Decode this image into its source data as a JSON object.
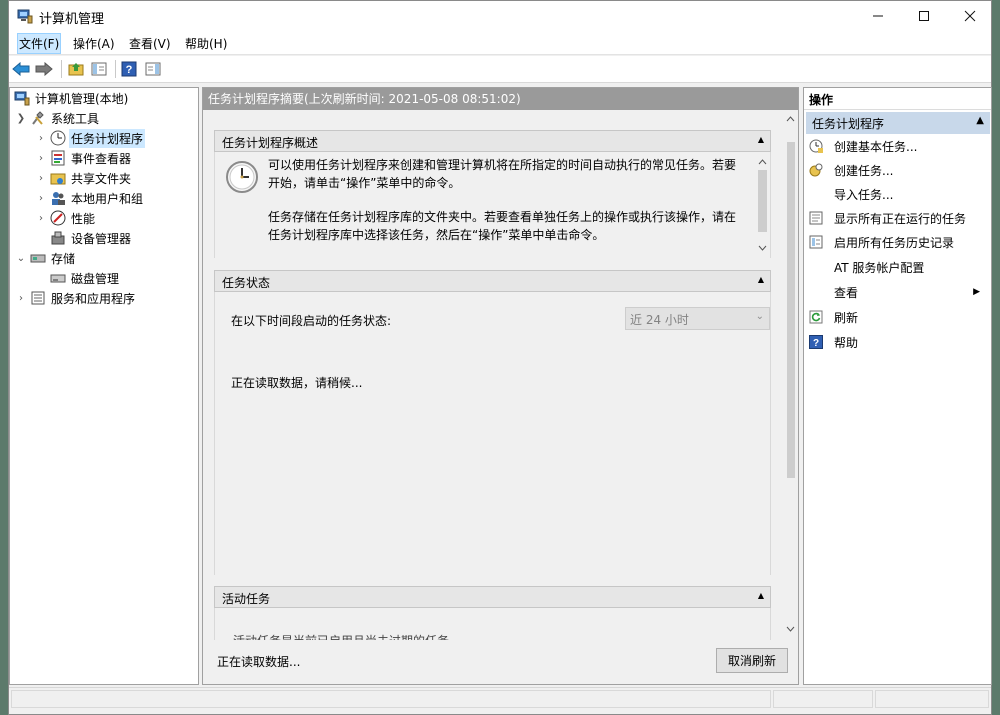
{
  "window": {
    "title": "计算机管理"
  },
  "menu": [
    "文件(F)",
    "操作(A)",
    "查看(V)",
    "帮助(H)"
  ],
  "tree": {
    "root": "计算机管理(本地)",
    "system_tools": "系统工具",
    "task_scheduler": "任务计划程序",
    "event_viewer": "事件查看器",
    "shared_folders": "共享文件夹",
    "local_users": "本地用户和组",
    "performance": "性能",
    "device_manager": "设备管理器",
    "storage": "存储",
    "disk_management": "磁盘管理",
    "services_apps": "服务和应用程序"
  },
  "center": {
    "header": "任务计划程序摘要(上次刷新时间: 2021-05-08 08:51:02)",
    "overview": {
      "title": "任务计划程序概述",
      "para1_line1": "可以使用任务计划程序来创建和管理计算机将在所指定的时间自动执行的常见任务。若要",
      "para1_line2": "开始，请单击“操作”菜单中的命令。",
      "para2_line1": "任务存储在任务计划程序库的文件夹中。若要查看单独任务上的操作或执行该操作，请在",
      "para2_line2": "任务计划程序库中选择该任务，然后在“操作”菜单中单击命令。"
    },
    "status": {
      "title": "任务状态",
      "label": "在以下时间段启动的任务状态:",
      "period": "近 24 小时",
      "loading": "正在读取数据，请稍候..."
    },
    "active": {
      "title": "活动任务",
      "partial_text": "活动任务是当前已启用且尚未过期的任务。"
    },
    "footer_status": "正在读取数据...",
    "cancel_refresh": "取消刷新"
  },
  "actions": {
    "title": "操作",
    "group": "任务计划程序",
    "items": [
      {
        "label": "创建基本任务...",
        "icon": "create-basic-task-icon"
      },
      {
        "label": "创建任务...",
        "icon": "create-task-icon"
      },
      {
        "label": "导入任务...",
        "icon": ""
      },
      {
        "label": "显示所有正在运行的任务",
        "icon": "running-tasks-icon"
      },
      {
        "label": "启用所有任务历史记录",
        "icon": "history-icon"
      },
      {
        "label": "AT 服务帐户配置",
        "icon": ""
      },
      {
        "label": "查看",
        "icon": ""
      },
      {
        "label": "刷新",
        "icon": "refresh-icon"
      },
      {
        "label": "帮助",
        "icon": "help-icon"
      }
    ]
  }
}
